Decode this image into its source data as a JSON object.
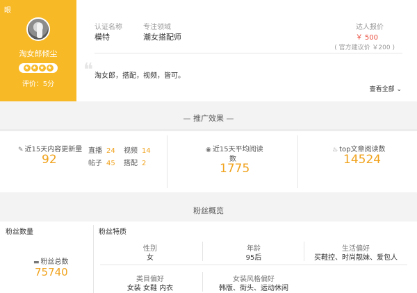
{
  "profile": {
    "corner_tag": "眼",
    "name": "淘女郎倾尘",
    "stars": [
      "★",
      "★",
      "★",
      "★"
    ],
    "rating_text": "评价：5分",
    "cert_label": "认证名称",
    "cert_value": "模特",
    "field_label": "专注领域",
    "field_value": "潮女搭配师",
    "price_label": "达人报价",
    "price_value": "￥ 500",
    "price_suggest": "( 官方建议价 ￥200 )",
    "description": "淘女郎，搭配，视频，皆可。",
    "view_all": "查看全部 ⌄",
    "quote_mark": "❝"
  },
  "promotion": {
    "title": "— 推广效果 —",
    "updates_label": "近15天内容更新量",
    "updates_icon": "✎",
    "updates_value": "92",
    "breakdown": [
      {
        "label": "直播",
        "value": "24"
      },
      {
        "label": "视频",
        "value": "14"
      },
      {
        "label": "帖子",
        "value": "45"
      },
      {
        "label": "搭配",
        "value": "2"
      }
    ],
    "avg_read_icon": "◉",
    "avg_read_label_1": "近15天平均阅读",
    "avg_read_label_2": "数",
    "avg_read_value": "1775",
    "top_icon": "♨",
    "top_label": "top文章阅读数",
    "top_value": "14524"
  },
  "fans": {
    "section_title": "粉丝概览",
    "count_title": "粉丝数量",
    "total_icon": "▬",
    "total_label": "粉丝总数",
    "total_value": "75740",
    "features_title": "粉丝特质",
    "features": [
      {
        "label": "性别",
        "value": "女"
      },
      {
        "label": "年龄",
        "value": "95后"
      },
      {
        "label": "生活偏好",
        "value": "买鞋控、时尚靓妹、爱包人"
      },
      {
        "label": "类目偏好",
        "value": "女装 女鞋 内衣"
      },
      {
        "label": "女装风格偏好",
        "value": "韩版、街头、运动休闲"
      }
    ]
  }
}
